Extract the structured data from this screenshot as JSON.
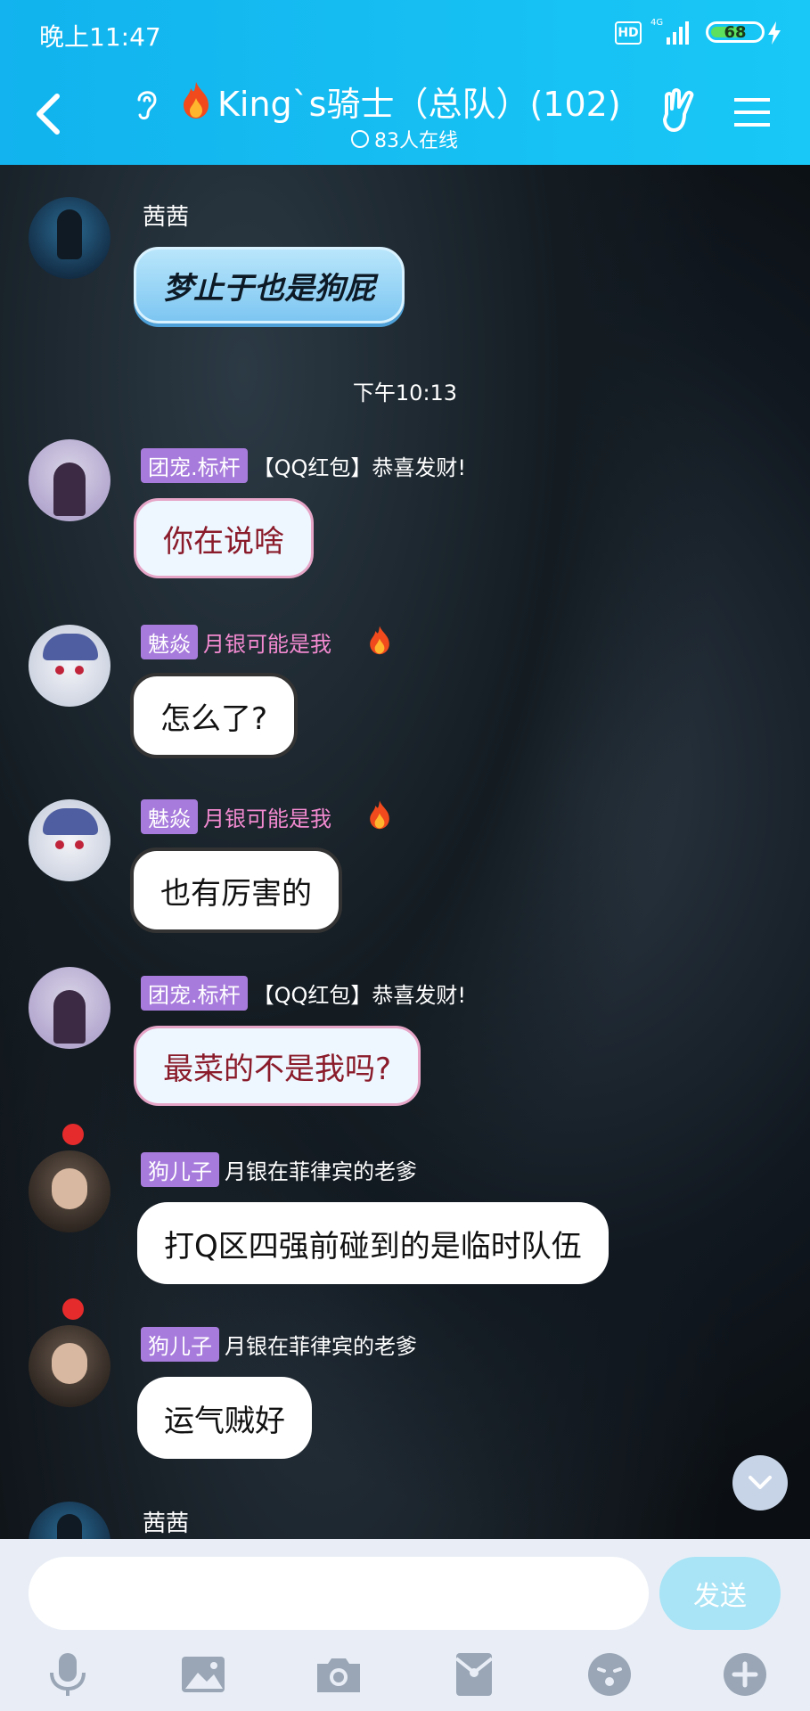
{
  "status": {
    "time": "晚上11:47",
    "hd": "HD",
    "network": "4G",
    "battery": "68",
    "battery_level": 0.68
  },
  "header": {
    "title": "King`s骑士（总队）(102)",
    "online": "83人在线"
  },
  "chat": {
    "timestamp": "下午10:13",
    "messages": [
      {
        "sender": "茜茜",
        "text": "梦止于也是狗屁"
      },
      {
        "tag": "团宠.标杆",
        "sender": "【QQ红包】恭喜发财!",
        "text": "你在说啥"
      },
      {
        "tag": "魅焱",
        "sender": "月银可能是我",
        "text": "怎么了?"
      },
      {
        "tag": "魅焱",
        "sender": "月银可能是我",
        "text": "也有厉害的"
      },
      {
        "tag": "团宠.标杆",
        "sender": "【QQ红包】恭喜发财!",
        "text": "最菜的不是我吗?"
      },
      {
        "tag": "狗儿子",
        "sender": "月银在菲律宾的老爹",
        "text": "打Q区四强前碰到的是临时队伍"
      },
      {
        "tag": "狗儿子",
        "sender": "月银在菲律宾的老爹",
        "text": "运气贼好"
      },
      {
        "sender": "茜茜"
      }
    ]
  },
  "input": {
    "placeholder": "",
    "send_label": "发送"
  },
  "toolbar": [
    "microphone-icon",
    "image-icon",
    "camera-icon",
    "red-packet-icon",
    "emoji-icon",
    "plus-icon"
  ],
  "colors": {
    "header": "#19c8f6",
    "tag": "#a77bdc",
    "send": "#a8e4f6"
  }
}
